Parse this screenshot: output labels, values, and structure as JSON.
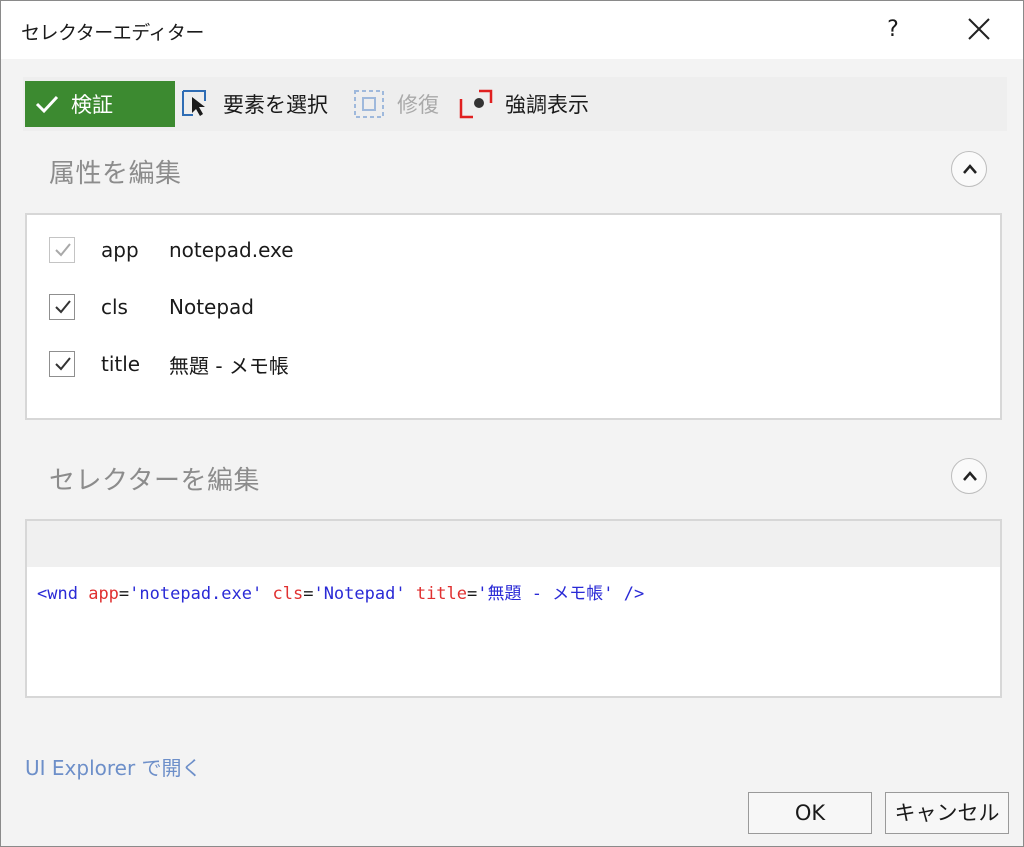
{
  "window": {
    "title": "セレクターエディター",
    "help_label": "?"
  },
  "toolbar": {
    "validate_label": "検証",
    "select_label": "要素を選択",
    "repair_label": "修復",
    "highlight_label": "強調表示"
  },
  "attributes_section": {
    "title": "属性を編集",
    "rows": [
      {
        "name": "app",
        "value": "notepad.exe",
        "checked": true,
        "enabled": false
      },
      {
        "name": "cls",
        "value": "Notepad",
        "checked": true,
        "enabled": true
      },
      {
        "name": "title",
        "value": "無題 - メモ帳",
        "checked": true,
        "enabled": true
      }
    ]
  },
  "selector_section": {
    "title": "セレクターを編集",
    "code": {
      "open": "<wnd",
      "a1_name": "app",
      "a1_value": "'notepad.exe'",
      "a2_name": "cls",
      "a2_value": "'Notepad'",
      "a3_name": "title",
      "a3_value": "'無題 - メモ帳'",
      "close": "/>"
    }
  },
  "footer": {
    "explorer_link": "UI Explorer で開く",
    "ok_label": "OK",
    "cancel_label": "キャンセル"
  },
  "colors": {
    "validate_bg": "#3c8a30",
    "code_tag": "#2a2ad6",
    "code_attr": "#e03131",
    "link": "#6d8fc9"
  }
}
